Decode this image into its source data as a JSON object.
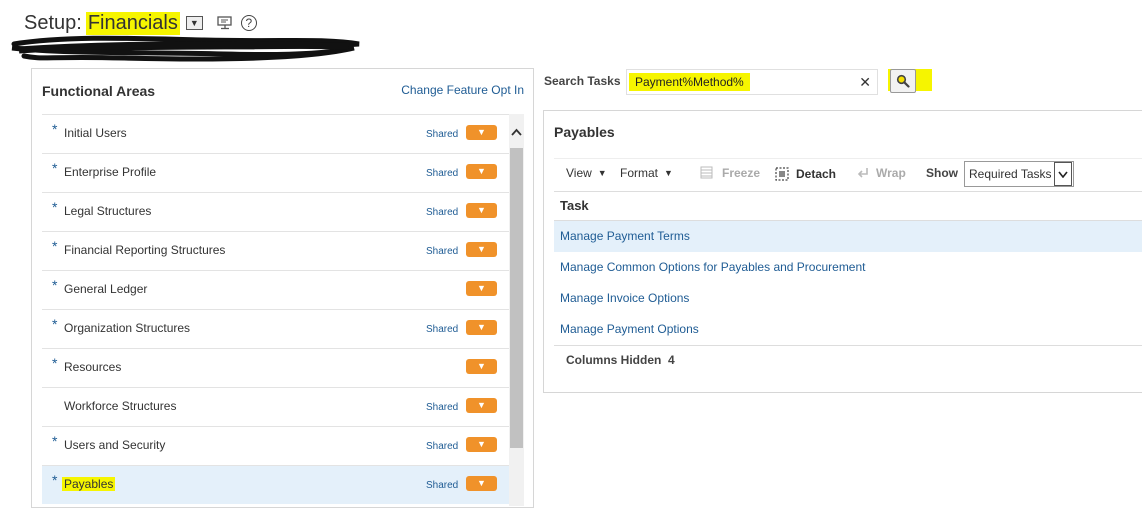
{
  "header": {
    "title_prefix": "Setup:",
    "title_name": "Financials",
    "dropdown_glyph": "▼",
    "help_glyph": "?",
    "highlight_color": "#f6f500"
  },
  "left_panel": {
    "title": "Functional Areas",
    "change_feature_link": "Change Feature Opt In",
    "items": [
      {
        "label": "Initial Users",
        "required": true,
        "shared": "Shared"
      },
      {
        "label": "Enterprise Profile",
        "required": true,
        "shared": "Shared"
      },
      {
        "label": "Legal Structures",
        "required": true,
        "shared": "Shared"
      },
      {
        "label": "Financial Reporting Structures",
        "required": true,
        "shared": "Shared"
      },
      {
        "label": "General Ledger",
        "required": true,
        "shared": ""
      },
      {
        "label": "Organization Structures",
        "required": true,
        "shared": "Shared"
      },
      {
        "label": "Resources",
        "required": true,
        "shared": ""
      },
      {
        "label": "Workforce Structures",
        "required": false,
        "shared": "Shared"
      },
      {
        "label": "Users and Security",
        "required": true,
        "shared": "Shared"
      },
      {
        "label": "Payables",
        "required": true,
        "shared": "Shared",
        "selected": true
      }
    ],
    "required_mark": "*",
    "option_button_color": "#f0922a"
  },
  "search": {
    "label": "Search Tasks",
    "value": "Payment%Method%",
    "clear_glyph": "✕"
  },
  "right_panel": {
    "title": "Payables",
    "toolbar": {
      "view": "View",
      "format": "Format",
      "freeze": "Freeze",
      "detach": "Detach",
      "wrap": "Wrap",
      "show_label": "Show",
      "show_value": "Required Tasks"
    },
    "table": {
      "column": "Task",
      "rows": [
        "Manage Payment Terms",
        "Manage Common Options for Payables and Procurement",
        "Manage Invoice Options",
        "Manage Payment Options"
      ],
      "columns_hidden_label": "Columns Hidden",
      "columns_hidden_count": "4"
    }
  }
}
